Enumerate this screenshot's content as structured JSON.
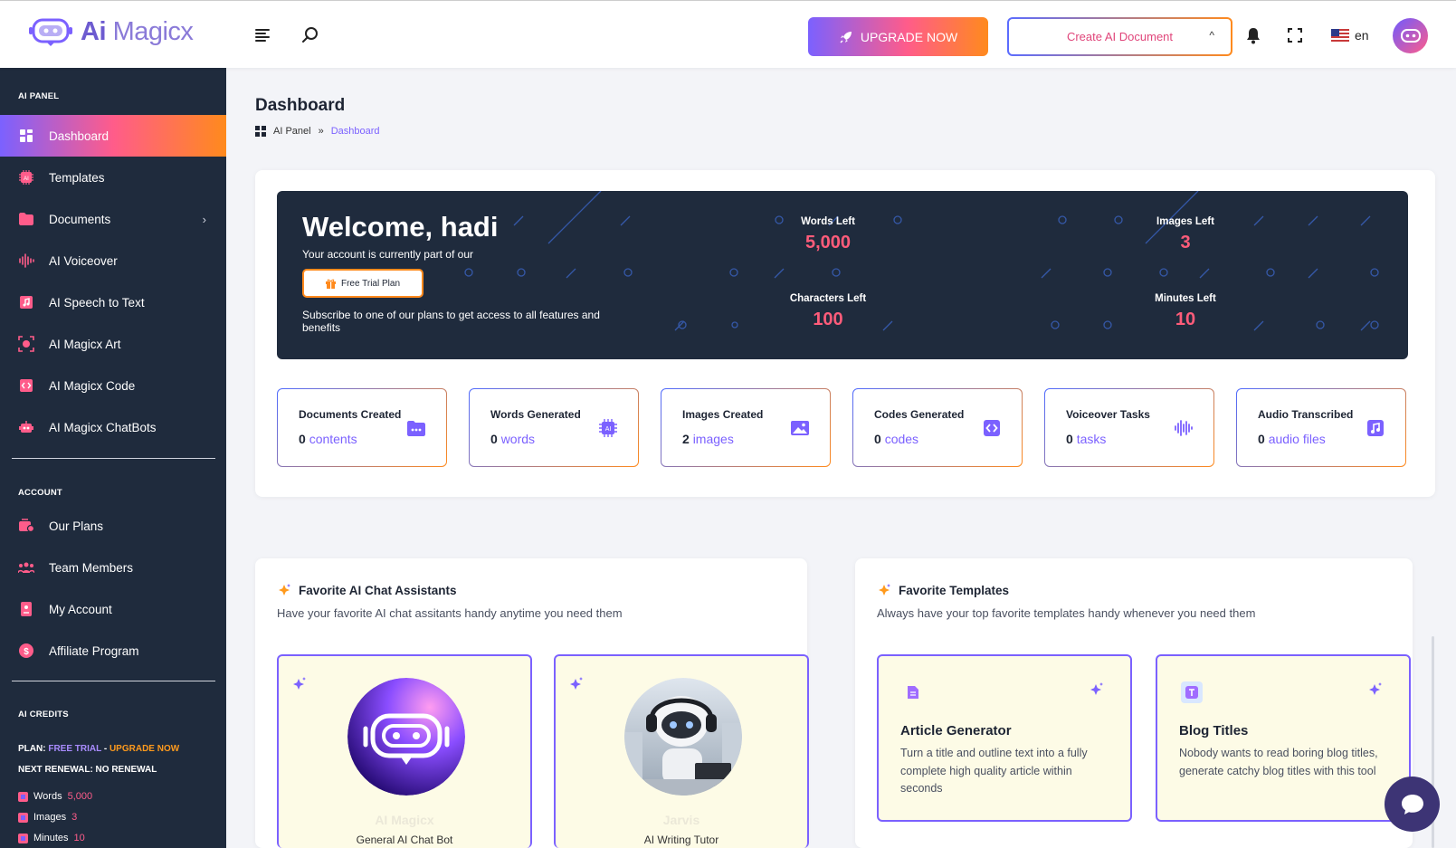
{
  "header": {
    "logo_text_ai": "Ai",
    "logo_text_rest": "Magicx",
    "upgrade_label": "UPGRADE NOW",
    "create_doc_label": "Create AI Document",
    "language": "en"
  },
  "sidebar": {
    "section_ai_panel": "AI PANEL",
    "items": [
      {
        "label": "Dashboard"
      },
      {
        "label": "Templates"
      },
      {
        "label": "Documents"
      },
      {
        "label": "AI Voiceover"
      },
      {
        "label": "AI Speech to Text"
      },
      {
        "label": "AI Magicx Art"
      },
      {
        "label": "AI Magicx Code"
      },
      {
        "label": "AI Magicx ChatBots"
      }
    ],
    "section_account": "ACCOUNT",
    "account_items": [
      {
        "label": "Our Plans"
      },
      {
        "label": "Team Members"
      },
      {
        "label": "My Account"
      },
      {
        "label": "Affiliate Program"
      }
    ],
    "section_credits": "AI CREDITS",
    "plan_prefix": "PLAN: ",
    "plan_name": "FREE TRIAL",
    "plan_sep": " - ",
    "plan_upgrade": "UPGRADE NOW",
    "renewal": "NEXT RENEWAL: NO RENEWAL",
    "credits": [
      {
        "label": "Words",
        "value": "5,000"
      },
      {
        "label": "Images",
        "value": "3"
      },
      {
        "label": "Minutes",
        "value": "10"
      }
    ]
  },
  "page": {
    "title": "Dashboard",
    "breadcrumb_root": "AI Panel",
    "breadcrumb_sep": "»",
    "breadcrumb_current": "Dashboard"
  },
  "hero": {
    "welcome": "Welcome, hadi",
    "sub": "Your account is currently part of our",
    "plan_button": "Free Trial Plan",
    "note": "Subscribe to one of our plans to get access to all features and benefits",
    "metrics": [
      {
        "label": "Words Left",
        "value": "5,000"
      },
      {
        "label": "Images Left",
        "value": "3"
      },
      {
        "label": "Characters Left",
        "value": "100"
      },
      {
        "label": "Minutes Left",
        "value": "10"
      }
    ]
  },
  "stats": [
    {
      "title": "Documents Created",
      "count": "0",
      "unit": "contents"
    },
    {
      "title": "Words Generated",
      "count": "0",
      "unit": "words"
    },
    {
      "title": "Images Created",
      "count": "2",
      "unit": "images"
    },
    {
      "title": "Codes Generated",
      "count": "0",
      "unit": "codes"
    },
    {
      "title": "Voiceover Tasks",
      "count": "0",
      "unit": "tasks"
    },
    {
      "title": "Audio Transcribed",
      "count": "0",
      "unit": "audio files"
    }
  ],
  "fav_assistants": {
    "title": "Favorite AI Chat Assistants",
    "sub": "Have your favorite AI chat assitants handy anytime you need them",
    "bots": [
      {
        "name": "AI Magicx",
        "role": "General AI Chat Bot"
      },
      {
        "name": "Jarvis",
        "role": "AI Writing Tutor"
      }
    ]
  },
  "fav_templates": {
    "title": "Favorite Templates",
    "sub": "Always have your top favorite templates handy whenever you need them",
    "templates": [
      {
        "title": "Article Generator",
        "desc": "Turn a title and outline text into a fully complete high quality article within seconds"
      },
      {
        "title": "Blog Titles",
        "desc": "Nobody wants to read boring blog titles, generate catchy blog titles with this tool"
      }
    ]
  },
  "colors": {
    "sidebar_bg": "#1f2b3d",
    "accent_purple": "#7b61ff",
    "accent_pink": "#ff5c8a",
    "accent_orange": "#ff8a1d"
  }
}
